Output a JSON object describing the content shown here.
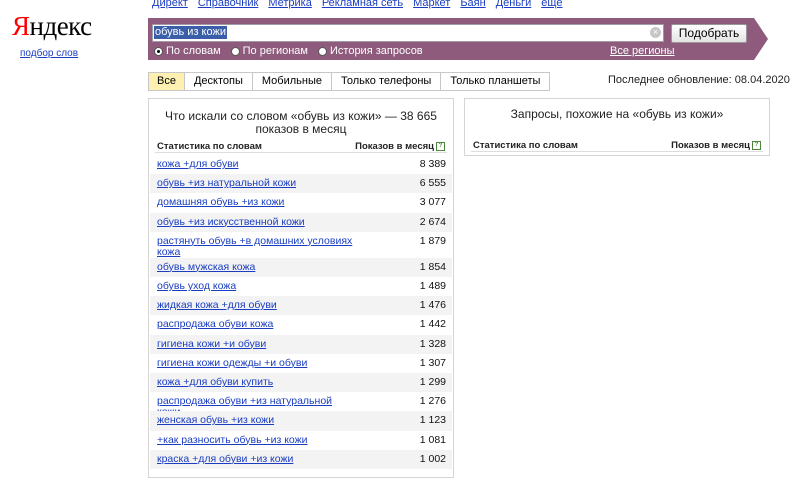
{
  "logo": {
    "text_first": "Я",
    "text_rest": "ндекс",
    "subtitle": "подбор слов"
  },
  "topnav": [
    "Директ",
    "Справочник",
    "Метрика",
    "Рекламная сеть",
    "Маркет",
    "Баян",
    "Деньги",
    "ещё"
  ],
  "search": {
    "value": "обувь из кожи",
    "submit_label": "Подобрать",
    "clear_icon": "×"
  },
  "radios": [
    {
      "label": "По словам",
      "selected": true
    },
    {
      "label": "По регионам",
      "selected": false
    },
    {
      "label": "История запросов",
      "selected": false
    }
  ],
  "regions_link": "Все регионы",
  "tabs": [
    {
      "label": "Все",
      "active": true
    },
    {
      "label": "Десктопы",
      "active": false
    },
    {
      "label": "Мобильные",
      "active": false
    },
    {
      "label": "Только телефоны",
      "active": false
    },
    {
      "label": "Только планшеты",
      "active": false
    }
  ],
  "updated": "Последнее обновление: 08.04.2020",
  "left_panel": {
    "title_line1": "Что искали со словом «обувь из кожи» — 38 665",
    "title_line2": "показов в месяц",
    "col_words": "Статистика по словам",
    "col_shows": "Показов в месяц",
    "help_icon": "?",
    "rows": [
      {
        "keyword": "кожа +для обуви",
        "count": "8 389"
      },
      {
        "keyword": "обувь +из натуральной кожи",
        "count": "6 555"
      },
      {
        "keyword": "домашняя обувь +из кожи",
        "count": "3 077"
      },
      {
        "keyword": "обувь +из искусственной кожи",
        "count": "2 674"
      },
      {
        "keyword": "растянуть обувь +в домашних условиях кожа",
        "count": "1 879"
      },
      {
        "keyword": "обувь мужская кожа",
        "count": "1 854"
      },
      {
        "keyword": "обувь уход кожа",
        "count": "1 489"
      },
      {
        "keyword": "жидкая кожа +для обуви",
        "count": "1 476"
      },
      {
        "keyword": "распродажа обуви кожа",
        "count": "1 442"
      },
      {
        "keyword": "гигиена кожи +и обуви",
        "count": "1 328"
      },
      {
        "keyword": "гигиена кожи одежды +и обуви",
        "count": "1 307"
      },
      {
        "keyword": "кожа +для обуви купить",
        "count": "1 299"
      },
      {
        "keyword": "распродажа обуви +из натуральной кожи",
        "count": "1 276"
      },
      {
        "keyword": "женская обувь +из кожи",
        "count": "1 123"
      },
      {
        "keyword": "+как разносить обувь +из кожи",
        "count": "1 081"
      },
      {
        "keyword": "краска +для обуви +из кожи",
        "count": "1 002"
      }
    ]
  },
  "right_panel": {
    "title": "Запросы, похожие на «обувь из кожи»",
    "col_words": "Статистика по словам",
    "col_shows": "Показов в месяц",
    "help_icon": "?"
  }
}
